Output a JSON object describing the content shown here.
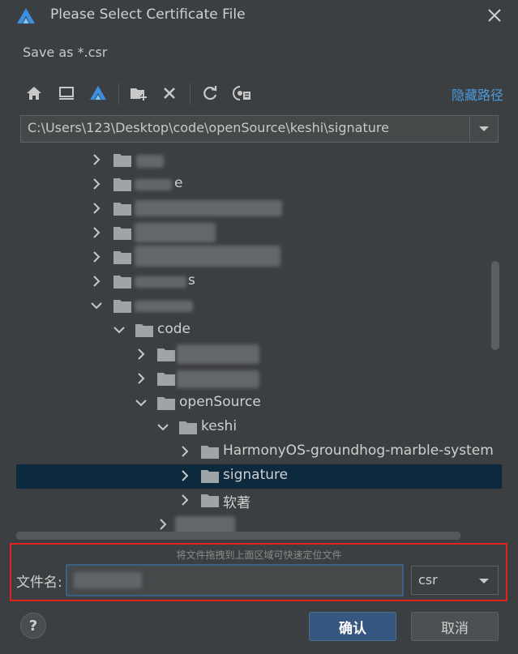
{
  "dialog": {
    "title": "Please Select Certificate File",
    "subtitle": "Save as *.csr",
    "hide_path_label": "隐藏路径",
    "path": "C:\\Users\\123\\Desktop\\code\\openSource\\keshi\\signature"
  },
  "toolbar": {
    "icons": [
      "home-icon",
      "desktop-icon",
      "project-icon",
      "new-folder-icon",
      "delete-icon",
      "refresh-icon",
      "show-hidden-icon"
    ]
  },
  "tree": {
    "rows": [
      {
        "label": "",
        "redacted": true,
        "expanded": false
      },
      {
        "label": "e",
        "redacted": true,
        "expanded": false
      },
      {
        "label": "",
        "redacted": true,
        "expanded": false
      },
      {
        "label": "",
        "redacted": true,
        "expanded": false
      },
      {
        "label": "",
        "redacted": true,
        "expanded": false
      },
      {
        "label": "s",
        "redacted": true,
        "expanded": false
      },
      {
        "label": "",
        "redacted": true,
        "expanded": true
      },
      {
        "label": "code",
        "redacted": false,
        "expanded": true
      },
      {
        "label": "",
        "redacted": true,
        "expanded": false
      },
      {
        "label": "",
        "redacted": true,
        "expanded": false
      },
      {
        "label": "openSource",
        "redacted": false,
        "expanded": true
      },
      {
        "label": "keshi",
        "redacted": false,
        "expanded": true
      },
      {
        "label": "HarmonyOS-groundhog-marble-system",
        "redacted": false,
        "expanded": false
      },
      {
        "label": "signature",
        "redacted": false,
        "expanded": false,
        "selected": true
      },
      {
        "label": "软著",
        "redacted": false,
        "expanded": false
      },
      {
        "label": "",
        "redacted": true,
        "expanded": false
      }
    ]
  },
  "footer": {
    "drag_hint": "将文件拖拽到上面区域可快速定位文件",
    "filename_label": "文件名:",
    "filename_value": "",
    "extension": "csr",
    "help_label": "?",
    "ok_label": "确认",
    "cancel_label": "取消"
  },
  "colors": {
    "background": "#3c3f41",
    "selection": "#0d293e",
    "link": "#4a9be0",
    "primary_button": "#365880",
    "highlight_border": "#e2231a"
  }
}
